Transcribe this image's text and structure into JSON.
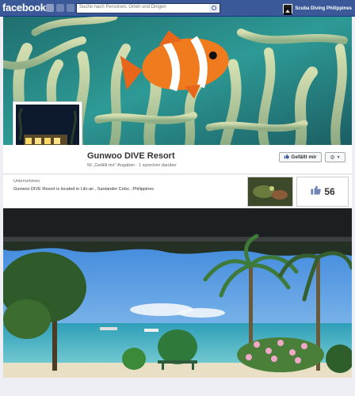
{
  "topbar": {
    "logo": "facebook",
    "search_placeholder": "Suche nach Personen, Orten und Dingen",
    "page_switcher_label": "Scuba Diving Philippines"
  },
  "page": {
    "name": "Gunwoo DIVE Resort",
    "stats": "56 „Gefällt mir“-Angaben · 1 sprechen darüber",
    "like_button_label": "Gefällt mir",
    "category": "Unternehmen",
    "description": "Gunwoo DIVE Resort is located in Lilo-an , Santander Cebu , Philippines",
    "likes_count": "56"
  },
  "colors": {
    "brand": "#3b5998",
    "cover_water": "#2b8f8e",
    "clownfish": "#f07a1e"
  }
}
